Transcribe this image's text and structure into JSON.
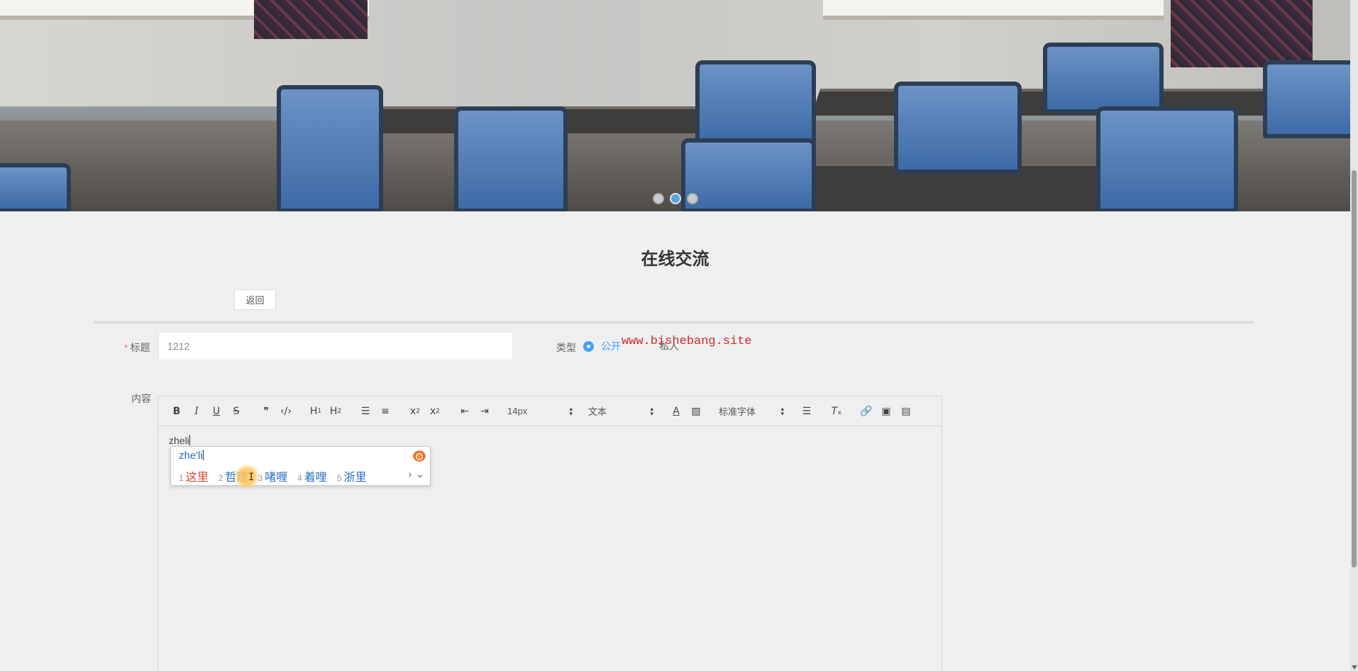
{
  "banner": {
    "dots": [
      {
        "active": false
      },
      {
        "active": true
      },
      {
        "active": false
      }
    ]
  },
  "page": {
    "title": "在线交流",
    "back_label": "返回"
  },
  "form": {
    "title_label": "标题",
    "title_value": "1212",
    "type_label": "类型",
    "type_options": [
      "公开",
      "私人"
    ],
    "type_selected": "公开",
    "content_label": "内容"
  },
  "watermark": "www.bishebang.site",
  "editor": {
    "toolbar": {
      "font_size": "14px",
      "header_select": "文本",
      "font_family": "标准字体"
    },
    "content_text": "zheli"
  },
  "ime": {
    "composition": "zhe'li",
    "candidates": [
      {
        "num": "1",
        "text": "这里"
      },
      {
        "num": "2",
        "text": "哲理"
      },
      {
        "num": "3",
        "text": "啫喱"
      },
      {
        "num": "4",
        "text": "着哩"
      },
      {
        "num": "5",
        "text": "浙里"
      }
    ],
    "next_icon": "›",
    "expand_icon": "⌄"
  },
  "colors": {
    "accent": "#409eff",
    "watermark": "#d02a2a",
    "candidate_primary": "#d9432b",
    "candidate": "#2b6fc2"
  }
}
